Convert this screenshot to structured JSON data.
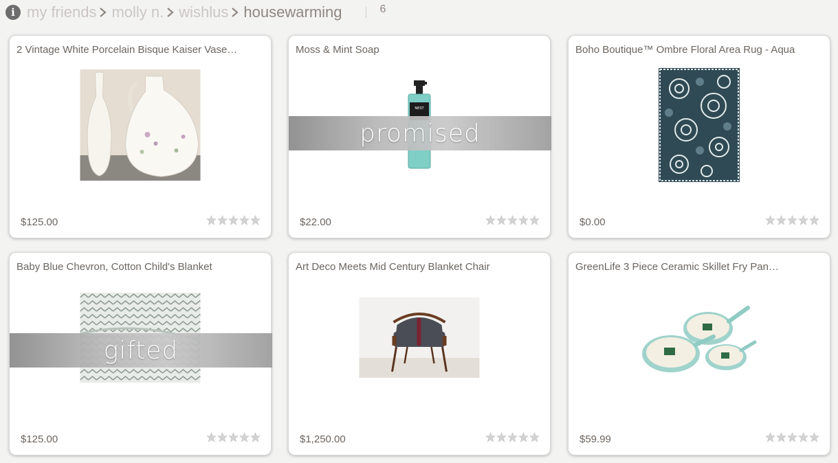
{
  "breadcrumb": {
    "items": [
      "my friends",
      "molly n.",
      "wishlus"
    ],
    "current": "housewarming",
    "count": "6"
  },
  "colors": {
    "accent": "#8f8781",
    "text": "#6b6560",
    "crumb": "#cbc6c1"
  },
  "items": [
    {
      "title": "2 Vintage White Porcelain Bisque Kaiser Vase…",
      "price": "$125.00",
      "status": "",
      "rating": 0,
      "icon": "vase-photo"
    },
    {
      "title": "Moss & Mint Soap",
      "price": "$22.00",
      "status": "promised",
      "rating": 0,
      "icon": "soap-photo"
    },
    {
      "title": "Boho Boutique™ Ombre Floral Area Rug - Aqua",
      "price": "$0.00",
      "status": "",
      "rating": 0,
      "icon": "rug-photo"
    },
    {
      "title": "Baby Blue Chevron, Cotton Child's Blanket",
      "price": "$125.00",
      "status": "gifted",
      "rating": 0,
      "icon": "blanket-photo"
    },
    {
      "title": "Art Deco Meets Mid Century Blanket Chair",
      "price": "$1,250.00",
      "status": "",
      "rating": 0,
      "icon": "chair-photo"
    },
    {
      "title": "GreenLife 3 Piece Ceramic Skillet Fry Pan…",
      "price": "$59.99",
      "status": "",
      "rating": 0,
      "icon": "pans-photo"
    }
  ]
}
